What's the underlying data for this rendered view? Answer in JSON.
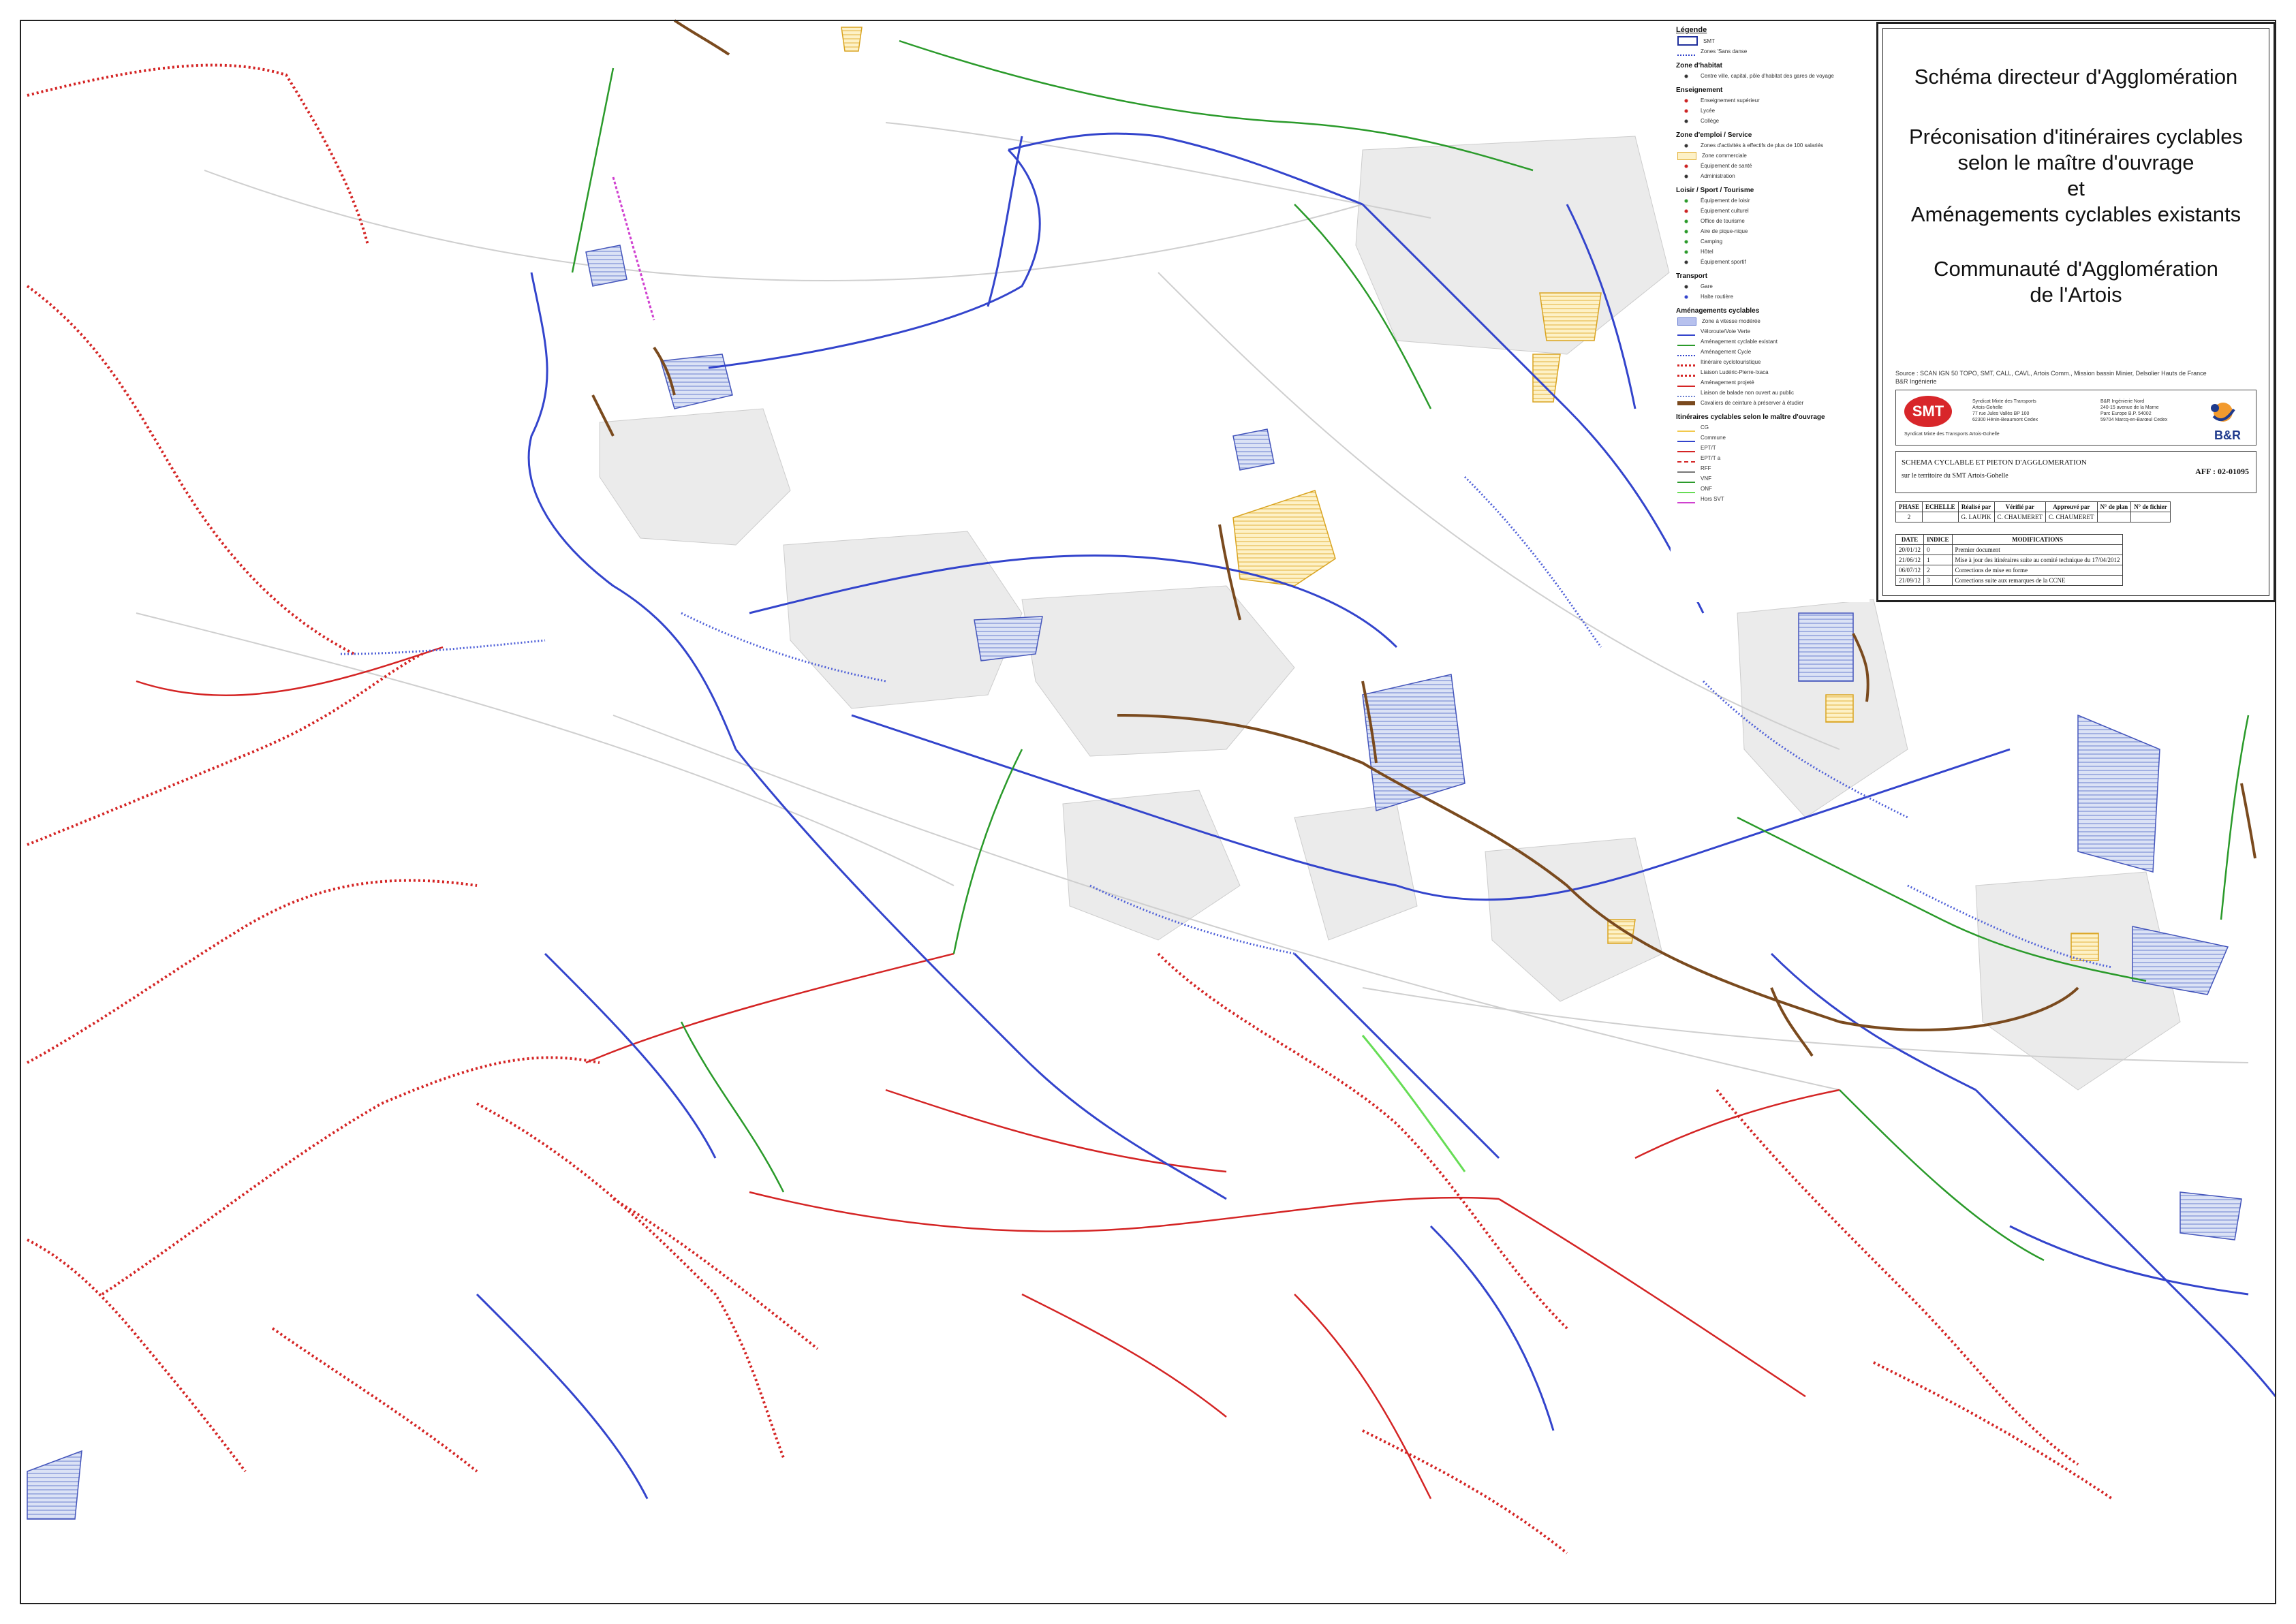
{
  "legend": {
    "title": "Légende",
    "groups": [
      {
        "heading": "",
        "items": [
          {
            "icon": "scot-boundary",
            "label": "SMT"
          },
          {
            "icon": "zone-dotted",
            "label": "Zones 'Sans danse"
          }
        ]
      },
      {
        "heading": "Zone d'habitat",
        "items": [
          {
            "icon": "town-centre-dot",
            "label": "Centre ville, capital, pôle d'habitat des gares de voyage"
          }
        ]
      },
      {
        "heading": "Enseignement",
        "items": [
          {
            "icon": "school-dot",
            "label": "Enseignement supérieur"
          },
          {
            "icon": "lycee-dot",
            "label": "Lycée"
          },
          {
            "icon": "college-dot",
            "label": "Collège"
          }
        ]
      },
      {
        "heading": "Zone d'emploi / Service",
        "items": [
          {
            "icon": "employment-dot",
            "label": "Zones d'activités à effectifs de plus de 100 salariés"
          },
          {
            "icon": "commercial-zone",
            "label": "Zone commerciale"
          },
          {
            "icon": "health-dot",
            "label": "Équipement de santé"
          },
          {
            "icon": "admin-dot",
            "label": "Administration"
          }
        ]
      },
      {
        "heading": "Loisir / Sport / Tourisme",
        "items": [
          {
            "icon": "leisure-dot",
            "label": "Équipement de loisir"
          },
          {
            "icon": "culture-dot",
            "label": "Équipement culturel"
          },
          {
            "icon": "tourism-dot",
            "label": "Office de tourisme"
          },
          {
            "icon": "tourist-site-dot",
            "label": "Aire de pique-nique"
          },
          {
            "icon": "camping-dot",
            "label": "Camping"
          },
          {
            "icon": "hotel-dot",
            "label": "Hôtel"
          },
          {
            "icon": "sport-dot",
            "label": "Équipement sportif"
          }
        ]
      },
      {
        "heading": "Transport",
        "items": [
          {
            "icon": "station-dot",
            "label": "Gare"
          },
          {
            "icon": "bus-dot",
            "label": "Halte routière"
          }
        ]
      },
      {
        "heading": "Aménagements cyclables",
        "items": [
          {
            "icon": "cycle-zone",
            "label": "Zone à vitesse modérée"
          },
          {
            "icon": "greenway",
            "label": "Véloroute/Voie Verte"
          },
          {
            "icon": "cycle-existing",
            "label": "Aménagement cyclable existant"
          },
          {
            "icon": "cycle-track",
            "label": "Aménagement Cycle"
          },
          {
            "icon": "dotted-red",
            "label": "Itinéraire cyclotouristique"
          },
          {
            "icon": "dotted-red-alt",
            "label": "Liaison Ludéric-Pierre-Ixaca"
          },
          {
            "icon": "cycle-project",
            "label": "Aménagement projeté"
          },
          {
            "icon": "cycle-dotted-blue",
            "label": "Liaison de balade non ouvert au public"
          },
          {
            "icon": "brown-planned",
            "label": "Cavaliers de ceinture à préserver à étudier"
          }
        ]
      },
      {
        "heading": "Itinéraires cyclables selon le maître d'ouvrage",
        "items": [
          {
            "icon": "route-cg",
            "label": "CG"
          },
          {
            "icon": "route-commune",
            "label": "Commune"
          },
          {
            "icon": "route-eptt",
            "label": "EPT/T"
          },
          {
            "icon": "route-eptt-a",
            "label": "EPT/T a"
          },
          {
            "icon": "route-rff",
            "label": "RFF"
          },
          {
            "icon": "route-vnf",
            "label": "VNF"
          },
          {
            "icon": "route-onf",
            "label": "ONF"
          },
          {
            "icon": "route-other",
            "label": "Hors SVT"
          }
        ]
      }
    ]
  },
  "title_block": {
    "line1": "Schéma directeur d'Agglomération",
    "line2a": "Préconisation d'itinéraires cyclables",
    "line2b": "selon le maître d'ouvrage",
    "line2c": "et",
    "line2d": "Aménagements cyclables existants",
    "line3a": "Communauté d'Agglomération",
    "line3b": "de l'Artois",
    "source_line1": "Source : SCAN IGN 50 TOPO, SMT, CALL, CAVL, Artois Comm., Mission bassin Minier, Delsolier Hauts de France",
    "source_line2": "B&R Ingénierie",
    "smt_logo": "SMT",
    "smt_caption": "Syndicat Mixte des Transports Artois-Gohelle",
    "smt_address": [
      "Syndicat Mixte des Transports",
      "Artois-Gohelle",
      "77 rue Jules Vallès BP 100",
      "62300 Hénin-Beaumont Cedex"
    ],
    "br_address": [
      "B&R Ingénierie Nord",
      "240-15 avenue de la Marne",
      "Parc Europe B.P. 54002",
      "59704 Marcq-en-Barœul Cedex"
    ],
    "br_logo": "B&R",
    "project_title": "SCHEMA CYCLABLE ET PIETON D'AGGLOMERATION",
    "project_subtitle": "sur le territoire du SMT Artois-Gohelle",
    "affaire": "AFF : 02-01095",
    "meta_headers": [
      "PHASE",
      "ECHELLE",
      "Réalisé par",
      "Vérifié par",
      "Approuvé par",
      "N° de plan",
      "N° de fichier"
    ],
    "meta_values": [
      "2",
      "",
      "G. LAUPIK",
      "C. CHAUMERET",
      "C. CHAUMERET",
      "",
      ""
    ],
    "rev_headers": [
      "DATE",
      "INDICE",
      "MODIFICATIONS"
    ],
    "revisions": [
      {
        "date": "20/01/12",
        "index": "0",
        "mod": "Premier document"
      },
      {
        "date": "21/06/12",
        "index": "1",
        "mod": "Mise à jour des itinéraires suite au comité technique du 17/04/2012"
      },
      {
        "date": "06/07/12",
        "index": "2",
        "mod": "Corrections de mise en forme"
      },
      {
        "date": "21/09/12",
        "index": "3",
        "mod": "Corrections suite aux remarques de la CCNE"
      }
    ]
  },
  "map": {
    "route_colors": {
      "blue": "#3344cc",
      "red": "#d42424",
      "green": "#2a9a2a",
      "brown": "#7a4a1e",
      "magenta": "#d040d0",
      "yellow": "#f2c94c",
      "light_green": "#66dd55"
    },
    "north_arrow": "north-arrow-icon"
  }
}
